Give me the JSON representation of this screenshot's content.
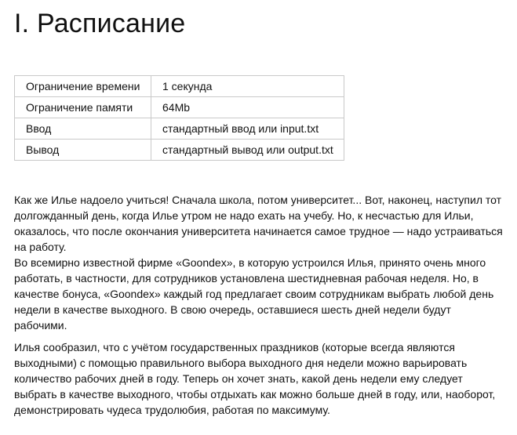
{
  "problem": {
    "title": "I. Расписание",
    "limits": [
      {
        "label": "Ограничение времени",
        "value": "1 секунда"
      },
      {
        "label": "Ограничение памяти",
        "value": "64Mb"
      },
      {
        "label": "Ввод",
        "value": "стандартный ввод или input.txt"
      },
      {
        "label": "Вывод",
        "value": "стандартный вывод или output.txt"
      }
    ],
    "paragraphs": [
      "Как же Илье надоело учиться! Сначала школа, потом университет... Вот, наконец, наступил тот долгожданный день, когда Илье утром не надо ехать на учебу. Но, к несчастью для Ильи, оказалось, что после окончания университета начинается самое трудное — надо устраиваться на работу.",
      "Во всемирно известной фирме «Goondex», в которую устроился Илья, принято очень много работать, в частности, для сотрудников установлена шестидневная рабочая неделя. Но, в качестве бонуса, «Goondex» каждый год предлагает своим сотрудникам выбрать любой день недели в качестве выходного. В свою очередь, оставшиеся шесть дней недели будут рабочими.",
      "Илья сообразил, что с учётом государственных праздников (которые всегда являются выходными) с помощью правильного выбора выходного дня недели можно варьировать количество рабочих дней в году. Теперь он хочет знать, какой день недели ему следует выбрать в качестве выходного, чтобы отдыхать как можно больше дней в году, или, наоборот, демонстрировать чудеса трудолюбия, работая по максимуму."
    ]
  }
}
